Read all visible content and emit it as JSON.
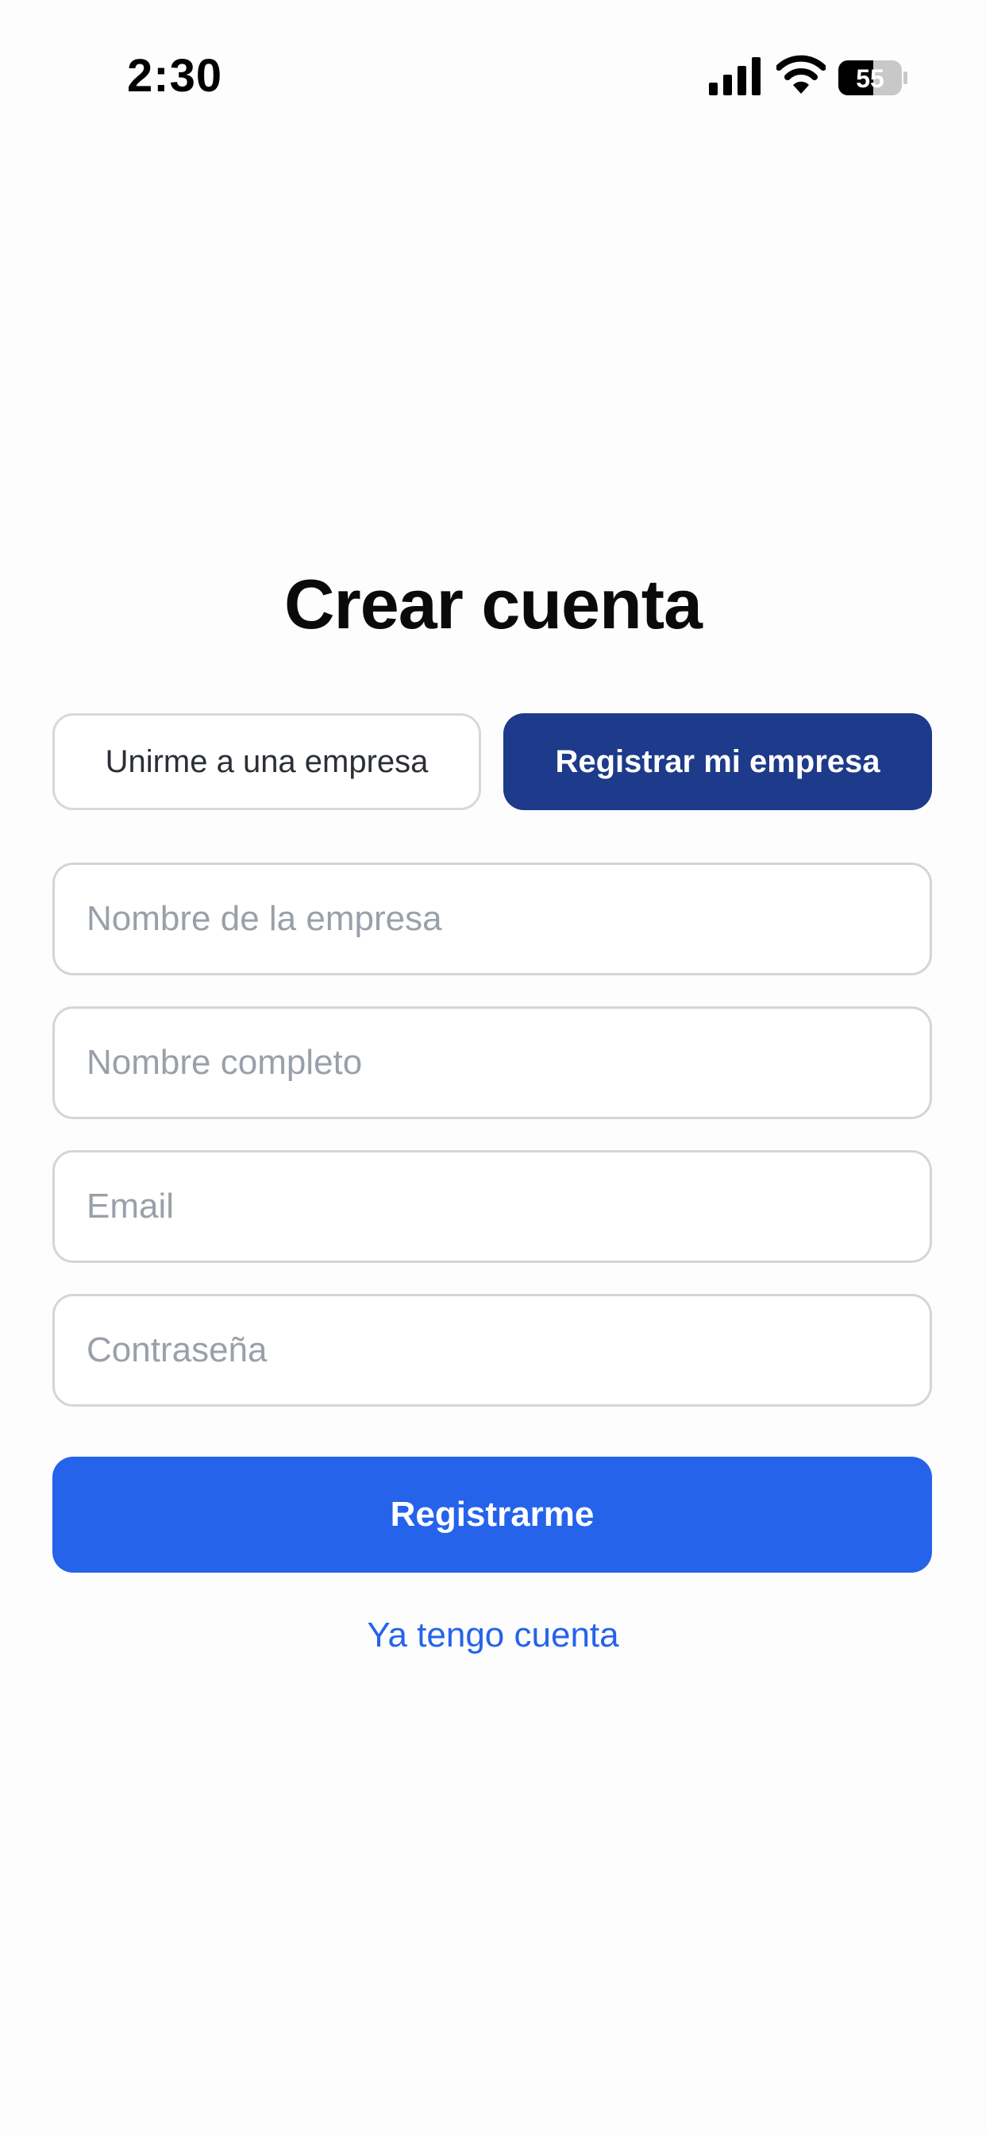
{
  "status_bar": {
    "time": "2:30",
    "battery_level": "55",
    "icons": [
      "signal-icon",
      "wifi-icon",
      "battery-icon"
    ]
  },
  "page": {
    "title": "Crear cuenta"
  },
  "mode_toggle": {
    "options": [
      {
        "label": "Unirme a una empresa",
        "selected": false
      },
      {
        "label": "Registrar mi empresa",
        "selected": true
      }
    ]
  },
  "form": {
    "company_name": {
      "placeholder": "Nombre de la empresa",
      "value": ""
    },
    "full_name": {
      "placeholder": "Nombre completo",
      "value": ""
    },
    "email": {
      "placeholder": "Email",
      "value": ""
    },
    "password": {
      "placeholder": "Contraseña",
      "value": ""
    },
    "submit_label": "Registrarme",
    "login_link": "Ya tengo cuenta"
  },
  "colors": {
    "primary": "#2563eb",
    "selected_segment": "#1e3a8a",
    "border": "#d3d5da",
    "placeholder": "#9aa0aa"
  }
}
